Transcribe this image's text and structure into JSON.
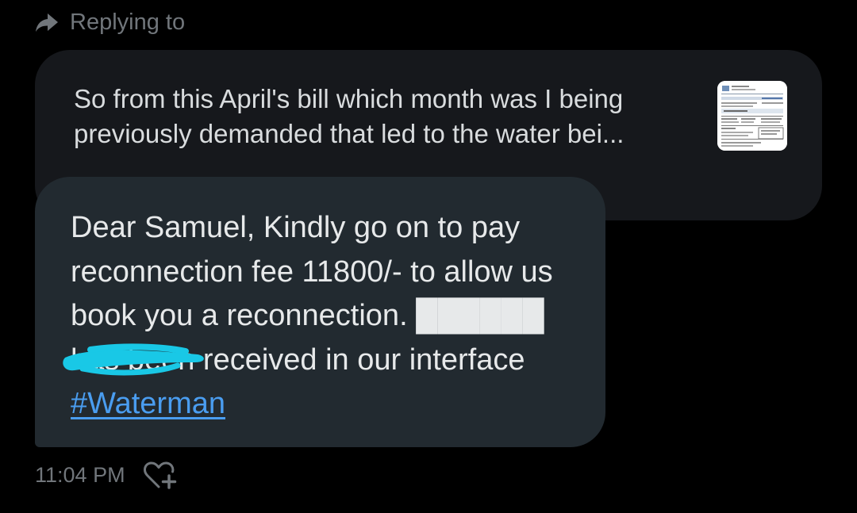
{
  "reply_header": {
    "icon": "reply-arrow-icon",
    "label": "Replying to"
  },
  "quoted_message": {
    "text": "So from this April's bill which month was I being previously demanded that led to the water bei...",
    "attachment_icon": "bill-document-thumbnail"
  },
  "message": {
    "text_before_hashtag": "Dear Samuel, Kindly go on to pay reconnection fee 11800/- to allow us book you a reconnection. ██████ has been received in our interface ",
    "hashtag": "#Waterman",
    "redaction_color": "#19c8e6"
  },
  "footer": {
    "timestamp": "11:04 PM",
    "reaction_icon": "add-reaction-heart-icon"
  },
  "colors": {
    "background": "#000000",
    "quoted_bubble": "#16181c",
    "message_bubble": "#222a30",
    "hashtag": "#4a9df0",
    "muted_text": "#71767b"
  }
}
